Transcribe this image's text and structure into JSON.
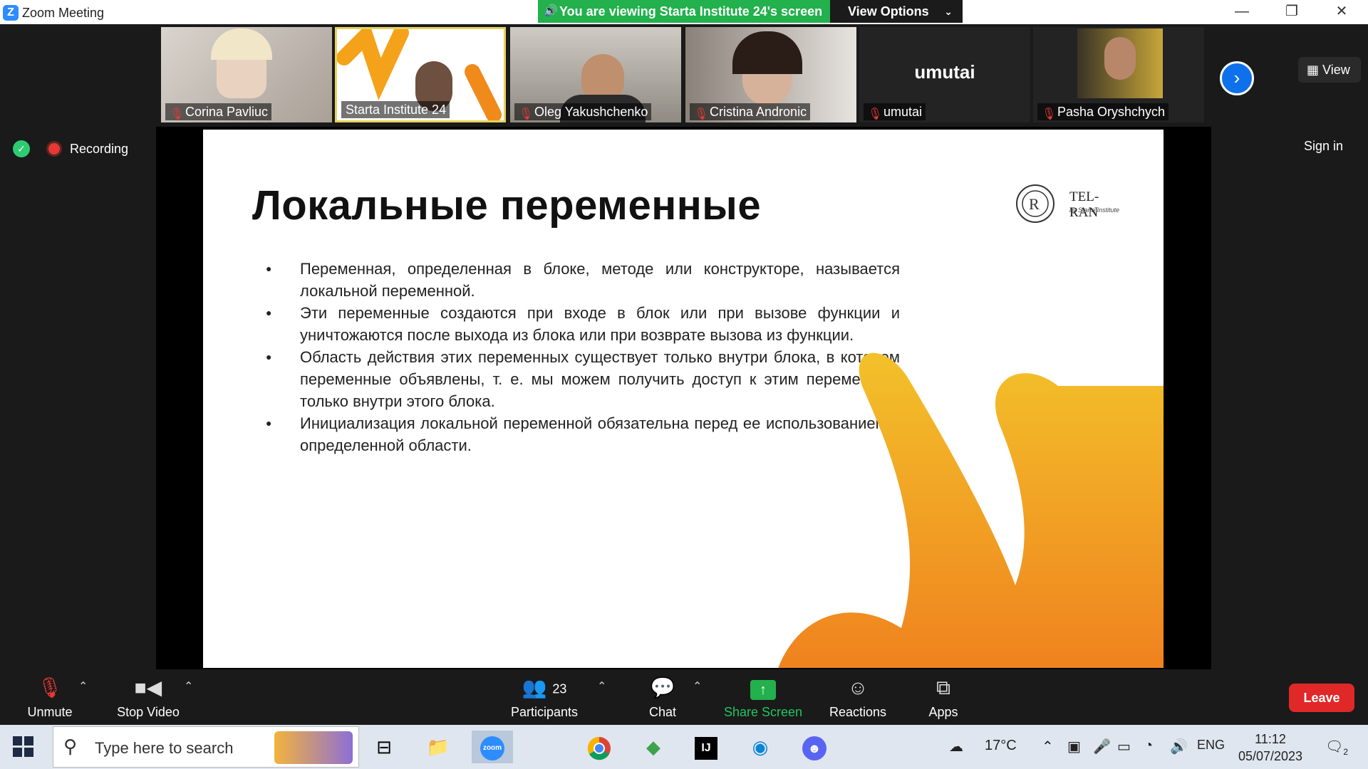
{
  "window": {
    "title": "Zoom Meeting",
    "viewing_banner": "You are viewing Starta Institute 24's screen",
    "view_options": "View Options",
    "minimize": "—",
    "restore": "❐",
    "close": "✕"
  },
  "participants_strip": [
    {
      "name": "Corina Pavliuc",
      "muted": true
    },
    {
      "name": "Starta Institute 24",
      "muted": false,
      "active": true
    },
    {
      "name": "Oleg Yakushchenko",
      "muted": true
    },
    {
      "name": "Cristina Andronic",
      "muted": true
    },
    {
      "name": "umutai",
      "muted": true,
      "big_label": "umutai"
    },
    {
      "name": "Pasha Oryshchych",
      "muted": true
    }
  ],
  "view_button": "View",
  "recording_label": "Recording",
  "sign_in": "Sign in",
  "slide": {
    "title": "Локальные переменные",
    "logo_brand": "TEL-RAN",
    "logo_sub": "by Starta Institute",
    "bullets": [
      "Переменная, определенная в блоке, методе или конструкторе, называется локальной переменной.",
      "Эти переменные создаются при входе в блок или при вызове функции и уничтожаются после выхода из блока или при возврате вызова из функции.",
      "Область действия этих переменных существует только внутри блока, в котором переменные объявлены, т. е. мы можем получить доступ к этим переменным только внутри этого блока.",
      "Инициализация локальной переменной обязательна перед ее использованием в определенной области."
    ]
  },
  "toolbar": {
    "unmute": "Unmute",
    "stop_video": "Stop Video",
    "participants": "Participants",
    "participants_count": "23",
    "chat": "Chat",
    "share_screen": "Share Screen",
    "reactions": "Reactions",
    "apps": "Apps",
    "leave": "Leave"
  },
  "taskbar": {
    "search_placeholder": "Type here to search",
    "weather": "17°C",
    "language": "ENG",
    "time": "11:12",
    "date": "05/07/2023",
    "notifications": "2"
  },
  "colors": {
    "zoom_blue": "#2d8cff",
    "banner_green": "#22b14c",
    "leave_red": "#e02828",
    "share_green": "#22b14c",
    "slide_orange": "#f5a21b"
  }
}
